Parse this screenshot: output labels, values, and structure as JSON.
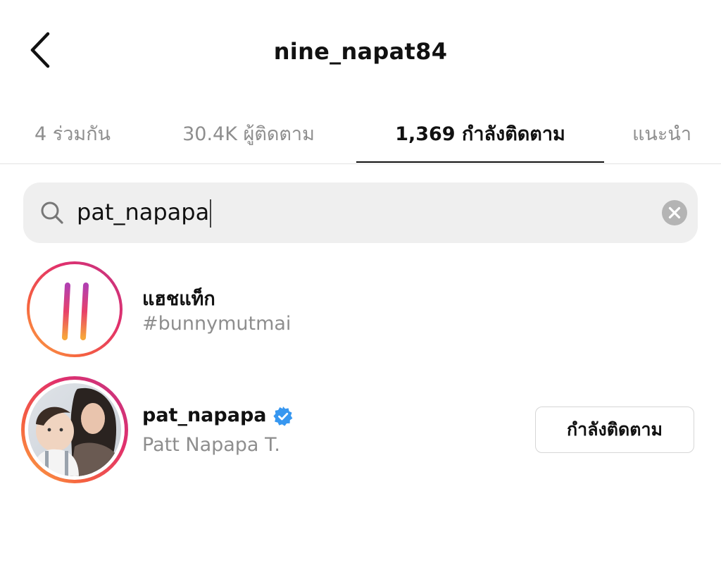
{
  "header": {
    "title": "nine_napat84",
    "back_icon": "chevron-left-icon"
  },
  "tabs": [
    {
      "label": "4 ร่วมกัน",
      "active": false
    },
    {
      "label": "30.4K ผู้ติดตาม",
      "active": false
    },
    {
      "label": "1,369 กำลังติดตาม",
      "active": true
    },
    {
      "label": "แนะนำ",
      "active": false
    }
  ],
  "search": {
    "value": "pat_napapa",
    "icon": "search-icon",
    "clear_icon": "clear-icon"
  },
  "results": [
    {
      "type": "hashtag",
      "title": "แฮชแท็ก",
      "subtitle": "#bunnymutmai",
      "icon": "hashtag-icon"
    },
    {
      "type": "user",
      "username": "pat_napapa",
      "full_name": "Patt Napapa T.",
      "verified": true,
      "button_label": "กำลังติดตาม"
    }
  ],
  "colors": {
    "accent_text": "#111111",
    "muted_text": "#8e8e8e",
    "search_bg": "#efefef",
    "verified_blue": "#3797f0",
    "story_ring_start": "#feda75",
    "story_ring_end": "#d62976"
  }
}
